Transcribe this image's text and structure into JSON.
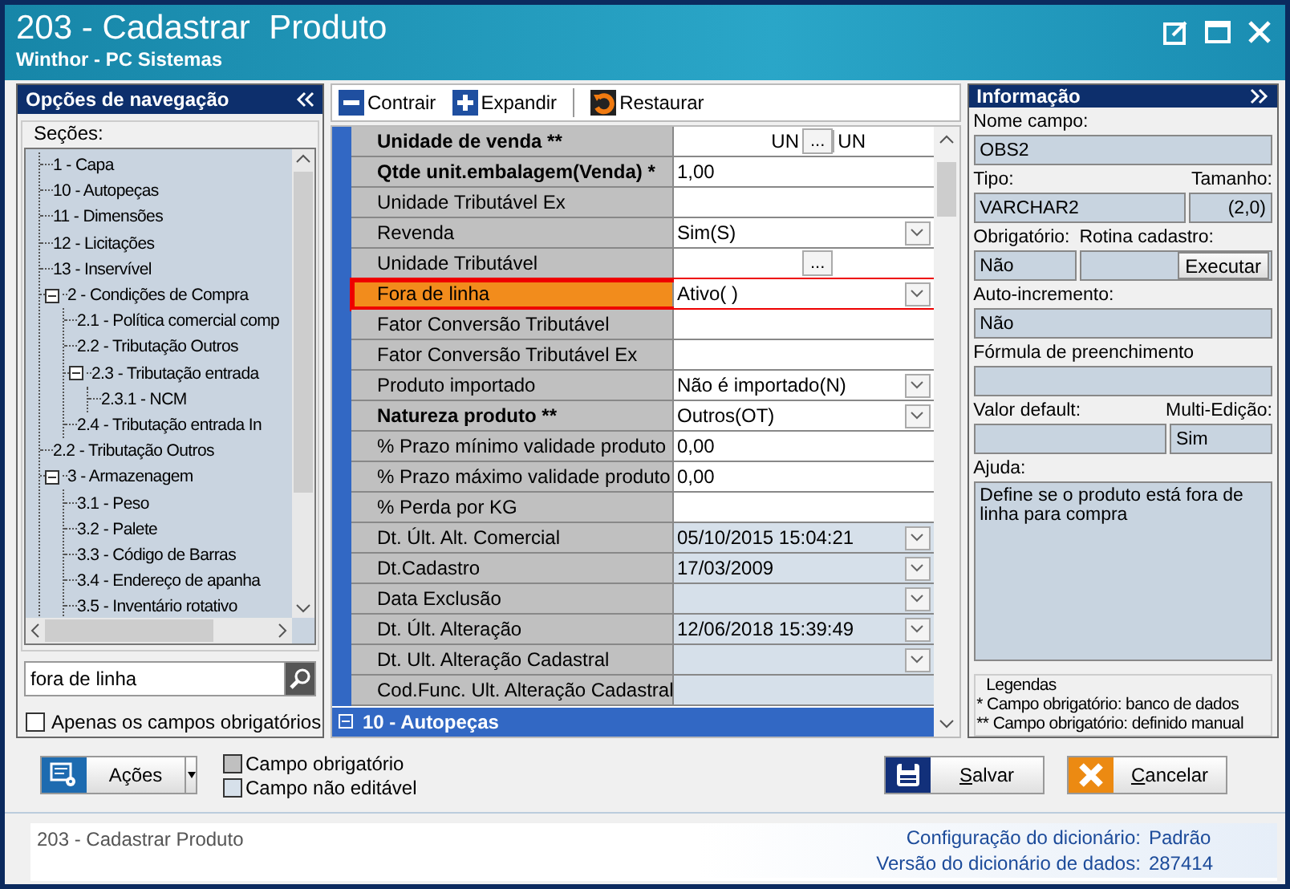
{
  "window": {
    "title": "203 - Cadastrar  Produto",
    "subtitle": "Winthor - PC Sistemas"
  },
  "nav": {
    "title": "Opções de navegação",
    "sections_label": "Seções:",
    "tree": [
      {
        "label": "1 - Capa"
      },
      {
        "label": "10 - Autopeças"
      },
      {
        "label": "11 - Dimensões"
      },
      {
        "label": "12 - Licitações"
      },
      {
        "label": "13 - Inservível"
      },
      {
        "label": "2 - Condições de Compra",
        "expanded": true,
        "children": [
          {
            "label": "2.1 - Política comercial comp"
          },
          {
            "label": "2.2 - Tributação Outros"
          },
          {
            "label": "2.3 - Tributação entrada",
            "expanded": true,
            "children": [
              {
                "label": "2.3.1 - NCM"
              }
            ]
          },
          {
            "label": "2.4 - Tributação entrada In"
          }
        ]
      },
      {
        "label": "2.2 - Tributação Outros"
      },
      {
        "label": "3 - Armazenagem",
        "expanded": true,
        "children": [
          {
            "label": "3.1 - Peso"
          },
          {
            "label": "3.2 - Palete"
          },
          {
            "label": "3.3 - Código de Barras"
          },
          {
            "label": "3.4 - Endereço de apanha"
          },
          {
            "label": "3.5 - Inventário rotativo"
          }
        ]
      }
    ],
    "search": {
      "value": "fora de linha"
    },
    "only_required": {
      "label": "Apenas os campos obrigatórios",
      "checked": false
    }
  },
  "toolbar": [
    {
      "kind": "collapse",
      "label": "Contrair"
    },
    {
      "kind": "expand",
      "label": "Expandir"
    },
    {
      "kind": "restore",
      "label": "Restaurar"
    }
  ],
  "grid": {
    "rows": [
      {
        "label": "Unidade de venda **",
        "required": true,
        "kind": "lookup",
        "value": "UN",
        "button": "...",
        "extra": "UN",
        "readonly": false,
        "highlighted": false
      },
      {
        "label": "Qtde unit.embalagem(Venda) *",
        "required": true,
        "kind": "text",
        "value": "1,00",
        "readonly": false,
        "highlighted": false
      },
      {
        "label": "Unidade Tributável Ex",
        "required": false,
        "kind": "text",
        "readonly": false,
        "highlighted": false
      },
      {
        "label": "Revenda",
        "required": false,
        "kind": "combo",
        "value": "Sim(S)",
        "readonly": false,
        "highlighted": false
      },
      {
        "label": "Unidade Tributável",
        "required": false,
        "kind": "lookup",
        "button": "...",
        "readonly": false,
        "highlighted": false
      },
      {
        "label": "Fora de linha",
        "required": false,
        "kind": "combo",
        "value": "Ativo( )",
        "readonly": false,
        "highlighted": true
      },
      {
        "label": "Fator Conversão Tributável",
        "required": false,
        "kind": "text",
        "readonly": false,
        "highlighted": false
      },
      {
        "label": "Fator Conversão Tributável Ex",
        "required": false,
        "kind": "text",
        "readonly": false,
        "highlighted": false
      },
      {
        "label": "Produto importado",
        "required": false,
        "kind": "combo",
        "value": "Não é importado(N)",
        "readonly": false,
        "highlighted": false
      },
      {
        "label": "Natureza produto **",
        "required": true,
        "kind": "combo",
        "value": "Outros(OT)",
        "readonly": false,
        "highlighted": false
      },
      {
        "label": "% Prazo mínimo validade produto",
        "required": false,
        "kind": "text",
        "value": "0,00",
        "readonly": false,
        "highlighted": false
      },
      {
        "label": "% Prazo máximo validade produto",
        "required": false,
        "kind": "text",
        "value": "0,00",
        "readonly": false,
        "highlighted": false
      },
      {
        "label": "% Perda por KG",
        "required": false,
        "kind": "text",
        "readonly": false,
        "highlighted": false
      },
      {
        "label": "Dt. Últ. Alt. Comercial",
        "required": false,
        "kind": "combo",
        "value": "05/10/2015 15:04:21",
        "readonly": true,
        "highlighted": false
      },
      {
        "label": "Dt.Cadastro",
        "required": false,
        "kind": "combo",
        "value": "17/03/2009",
        "readonly": true,
        "highlighted": false
      },
      {
        "label": "Data Exclusão",
        "required": false,
        "kind": "combo",
        "readonly": true,
        "highlighted": false
      },
      {
        "label": "Dt. Últ. Alteração",
        "required": false,
        "kind": "combo",
        "value": "12/06/2018 15:39:49",
        "readonly": true,
        "highlighted": false
      },
      {
        "label": "Dt. Ult. Alteração Cadastral",
        "required": false,
        "kind": "combo",
        "readonly": true,
        "highlighted": false
      },
      {
        "label": "Cod.Func. Ult. Alteração Cadastral",
        "required": false,
        "kind": "text",
        "readonly": true,
        "highlighted": false
      }
    ],
    "next_section": {
      "label": "10 - Autopeças",
      "expanded": true
    }
  },
  "info": {
    "title": "Informação",
    "nome_campo": {
      "label": "Nome campo:",
      "value": "OBS2"
    },
    "tipo": {
      "label": "Tipo:",
      "value": "VARCHAR2"
    },
    "tamanho": {
      "label": "Tamanho:",
      "value": "(2,0)"
    },
    "obrigatorio": {
      "label": "Obrigatório:",
      "value": "Não"
    },
    "rotina_cadastro": {
      "label": "Rotina cadastro:",
      "button": "Executar"
    },
    "auto_incremento": {
      "label": "Auto-incremento:",
      "value": "Não"
    },
    "formula": {
      "label": "Fórmula de preenchimento"
    },
    "valor_default": {
      "label": "Valor default:"
    },
    "multi_edicao": {
      "label": "Multi-Edição:",
      "value": "Sim"
    },
    "ajuda": {
      "label": "Ajuda:",
      "value": "Define se o produto está fora de linha para compra"
    },
    "legend": {
      "title": "Legendas",
      "lines": [
        "* Campo obrigatório: banco de dados",
        "** Campo obrigatório: definido manual"
      ]
    }
  },
  "actions_button": {
    "label": "Ações"
  },
  "legend_swatches": [
    {
      "label": "Campo obrigatório",
      "color": "#c0c0c0"
    },
    {
      "label": "Campo não editável",
      "color": "#d6e0ea"
    }
  ],
  "buttons": [
    {
      "kind": "save",
      "underline": "S",
      "rest": "alvar"
    },
    {
      "kind": "cancel",
      "underline": "C",
      "rest": "ancelar"
    }
  ],
  "status_bar": {
    "left": "203 - Cadastrar  Produto",
    "config_label": "Configuração do dicionário:",
    "config_value": "Padrão",
    "version_label": "Versão do dicionário de dados:",
    "version_value": "287414"
  }
}
